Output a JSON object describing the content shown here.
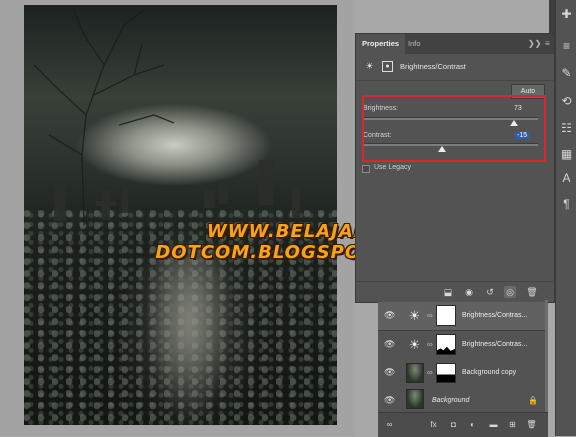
{
  "properties_panel": {
    "tabs": [
      {
        "label": "Properties"
      },
      {
        "label": "Info"
      }
    ],
    "tab_controls": {
      "expand": "❯❯",
      "menu": "≡"
    },
    "title": "Brightness/Contrast",
    "auto_label": "Auto",
    "brightness": {
      "label": "Brightness:",
      "value": "73",
      "level": 0.865
    },
    "contrast": {
      "label": "Contrast:",
      "value": "-15",
      "level": 0.45
    },
    "use_legacy": {
      "label": "Use Legacy",
      "checked": false
    }
  },
  "layers_panel": {
    "layers": [
      {
        "name": "Brightness/Contras...",
        "type": "adjustment",
        "selected": true
      },
      {
        "name": "Brightness/Contras...",
        "type": "adjustment",
        "selected": false
      },
      {
        "name": "Background copy",
        "type": "image",
        "selected": false
      },
      {
        "name": "Background",
        "type": "image",
        "selected": false,
        "locked": true
      }
    ]
  },
  "watermark": "WWW.BELAJAR-DOTCOM.BLOGSPOT.COM",
  "colors": {
    "highlight_red": "#d9272e",
    "panel_bg": "#535353",
    "watermark_orange": "#f7a21b"
  },
  "icons": {
    "adjustment": "brightness-contrast-icon",
    "eye": "eye-icon",
    "link": "chain-link-icon",
    "lock": "lock-icon"
  }
}
